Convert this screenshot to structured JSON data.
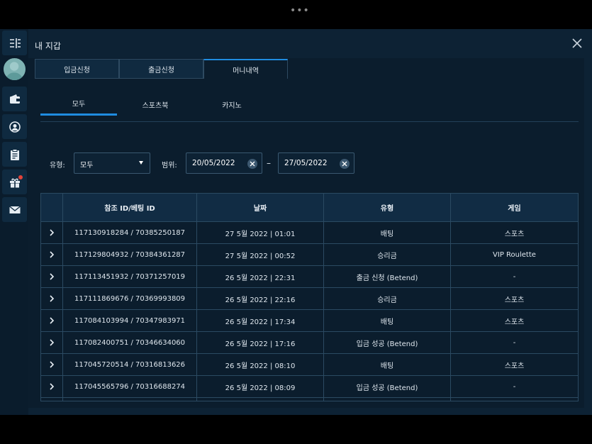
{
  "window": {
    "menu_dots": "•••",
    "title": "내 지갑"
  },
  "tabs": [
    {
      "label": "입금신청",
      "active": false
    },
    {
      "label": "출금신청",
      "active": false
    },
    {
      "label": "머니내역",
      "active": true
    }
  ],
  "subtabs": [
    {
      "label": "모두",
      "active": true
    },
    {
      "label": "스포츠북",
      "active": false
    },
    {
      "label": "카지노",
      "active": false
    }
  ],
  "filters": {
    "type_label": "유형:",
    "type_value": "모두",
    "range_label": "범위:",
    "date_from": "20/05/2022",
    "date_separator": "–",
    "date_to": "27/05/2022"
  },
  "table": {
    "headers": [
      "",
      "참조 ID/베팅 ID",
      "날짜",
      "유형",
      "게임"
    ],
    "rows": [
      {
        "ref": "117130918284 / 70385250187",
        "date": "27 5월 2022 | 01:01",
        "type": "배팅",
        "game": "스포츠"
      },
      {
        "ref": "117129804932 / 70384361287",
        "date": "27 5월 2022 | 00:52",
        "type": "승리금",
        "game": "VIP Roulette"
      },
      {
        "ref": "117113451932 / 70371257019",
        "date": "26 5월 2022 | 22:31",
        "type": "출금 신청 (Betend)",
        "game": "-"
      },
      {
        "ref": "117111869676 / 70369993809",
        "date": "26 5월 2022 | 22:16",
        "type": "승리금",
        "game": "스포츠"
      },
      {
        "ref": "117084103994 / 70347983971",
        "date": "26 5월 2022 | 17:34",
        "type": "배팅",
        "game": "스포츠"
      },
      {
        "ref": "117082400751 / 70346634060",
        "date": "26 5월 2022 | 17:16",
        "type": "입금 성공 (Betend)",
        "game": "-"
      },
      {
        "ref": "117045720514 / 70316813626",
        "date": "26 5월 2022 | 08:10",
        "type": "배팅",
        "game": "스포츠"
      },
      {
        "ref": "117045565796 / 70316688274",
        "date": "26 5월 2022 | 08:09",
        "type": "입금 성공 (Betend)",
        "game": "-"
      }
    ]
  },
  "colors": {
    "accent": "#1f8ce0",
    "background": "#0d2234",
    "notification": "#e2433a"
  }
}
